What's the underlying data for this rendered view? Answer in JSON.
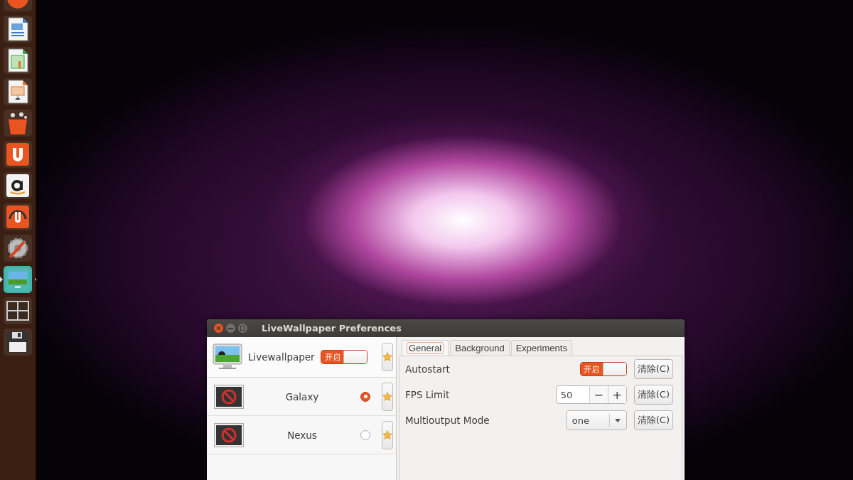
{
  "launcher": {
    "items": [
      {
        "kind": "orange-circle",
        "focused": false
      },
      {
        "kind": "writer",
        "focused": false
      },
      {
        "kind": "calc",
        "focused": false
      },
      {
        "kind": "impress",
        "focused": false
      },
      {
        "kind": "bag",
        "focused": false
      },
      {
        "kind": "u-app",
        "focused": false
      },
      {
        "kind": "amazon",
        "focused": false
      },
      {
        "kind": "u-headphones",
        "focused": false
      },
      {
        "kind": "tools",
        "focused": false
      },
      {
        "kind": "wallpaper",
        "focused": true
      },
      {
        "kind": "workspaces",
        "focused": false
      },
      {
        "kind": "floppy",
        "focused": false
      }
    ]
  },
  "window": {
    "title": "LiveWallpaper Preferences"
  },
  "sidebar": {
    "header": {
      "name": "Livewallpaper",
      "switch": {
        "label": "开启",
        "on": true
      }
    },
    "items": [
      {
        "name": "Galaxy",
        "selected": true
      },
      {
        "name": "Nexus",
        "selected": false
      }
    ]
  },
  "tabs": [
    {
      "label": "General",
      "selected": true
    },
    {
      "label": "Background",
      "selected": false
    },
    {
      "label": "Experiments",
      "selected": false
    }
  ],
  "settings": [
    {
      "kind": "switch",
      "label": "Autostart",
      "switch_label": "开启",
      "on": true,
      "clear": "清除(C)"
    },
    {
      "kind": "spin",
      "label": "FPS Limit",
      "value": "50",
      "minus": "−",
      "plus": "+",
      "clear": "清除(C)"
    },
    {
      "kind": "combo",
      "label": "Multioutput Mode",
      "value": "one",
      "clear": "清除(C)"
    }
  ]
}
